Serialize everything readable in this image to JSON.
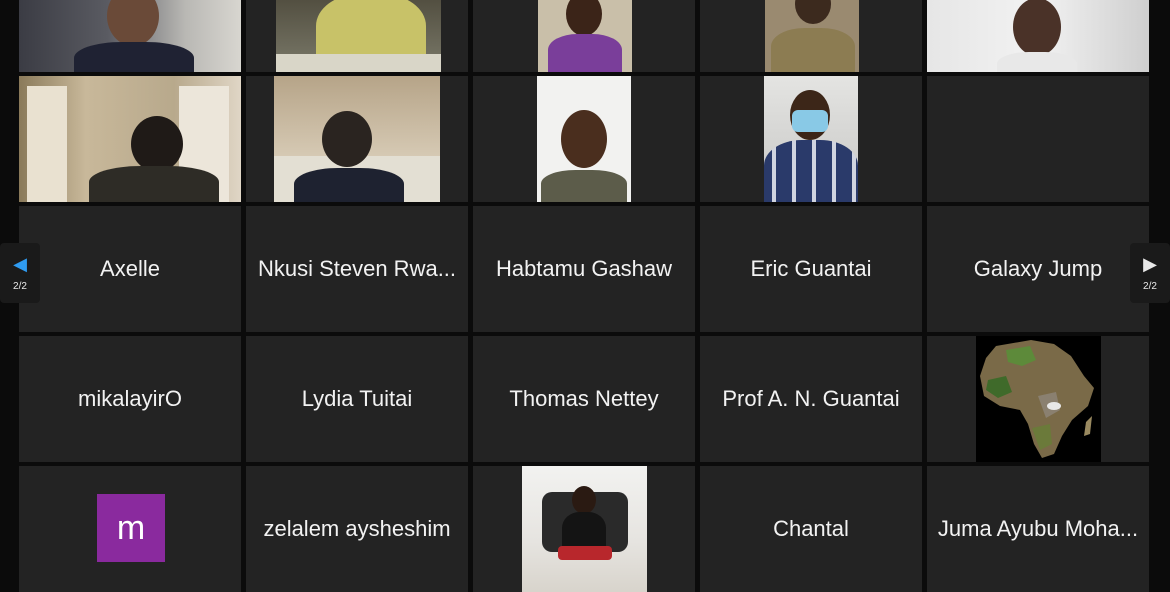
{
  "navigation": {
    "prev_page_label": "2/2",
    "next_page_label": "2/2"
  },
  "participants": [
    {
      "id": "r1c1",
      "type": "video"
    },
    {
      "id": "r1c2",
      "type": "video"
    },
    {
      "id": "r1c3",
      "type": "video"
    },
    {
      "id": "r1c4",
      "type": "video"
    },
    {
      "id": "r1c5",
      "type": "video"
    },
    {
      "id": "r2c1",
      "type": "video"
    },
    {
      "id": "r2c2",
      "type": "video"
    },
    {
      "id": "r2c3",
      "type": "video"
    },
    {
      "id": "r2c4",
      "type": "video"
    },
    {
      "id": "r2c5",
      "type": "empty"
    },
    {
      "id": "r3c1",
      "name": "Axelle"
    },
    {
      "id": "r3c2",
      "name": "Nkusi Steven Rwa..."
    },
    {
      "id": "r3c3",
      "name": "Habtamu Gashaw"
    },
    {
      "id": "r3c4",
      "name": "Eric Guantai"
    },
    {
      "id": "r3c5",
      "name": "Galaxy Jump"
    },
    {
      "id": "r4c1",
      "name": "mikalayirO"
    },
    {
      "id": "r4c2",
      "name": "Lydia Tuitai"
    },
    {
      "id": "r4c3",
      "name": "Thomas Nettey"
    },
    {
      "id": "r4c4",
      "name": "Prof A. N. Guantai"
    },
    {
      "id": "r4c5",
      "type": "profile-image"
    },
    {
      "id": "r5c1",
      "avatar_letter": "m"
    },
    {
      "id": "r5c2",
      "name": "zelalem aysheshim"
    },
    {
      "id": "r5c3",
      "type": "profile-image"
    },
    {
      "id": "r5c4",
      "name": "Chantal"
    },
    {
      "id": "r5c5",
      "name": "Juma Ayubu Moha..."
    }
  ],
  "icons": {
    "prev": "chevron-left-icon",
    "next": "chevron-right-icon"
  },
  "colors": {
    "background": "#0b0b0b",
    "tile": "#232323",
    "active_arrow": "#2f9bf0",
    "avatar_m": "#8a2a9e"
  }
}
